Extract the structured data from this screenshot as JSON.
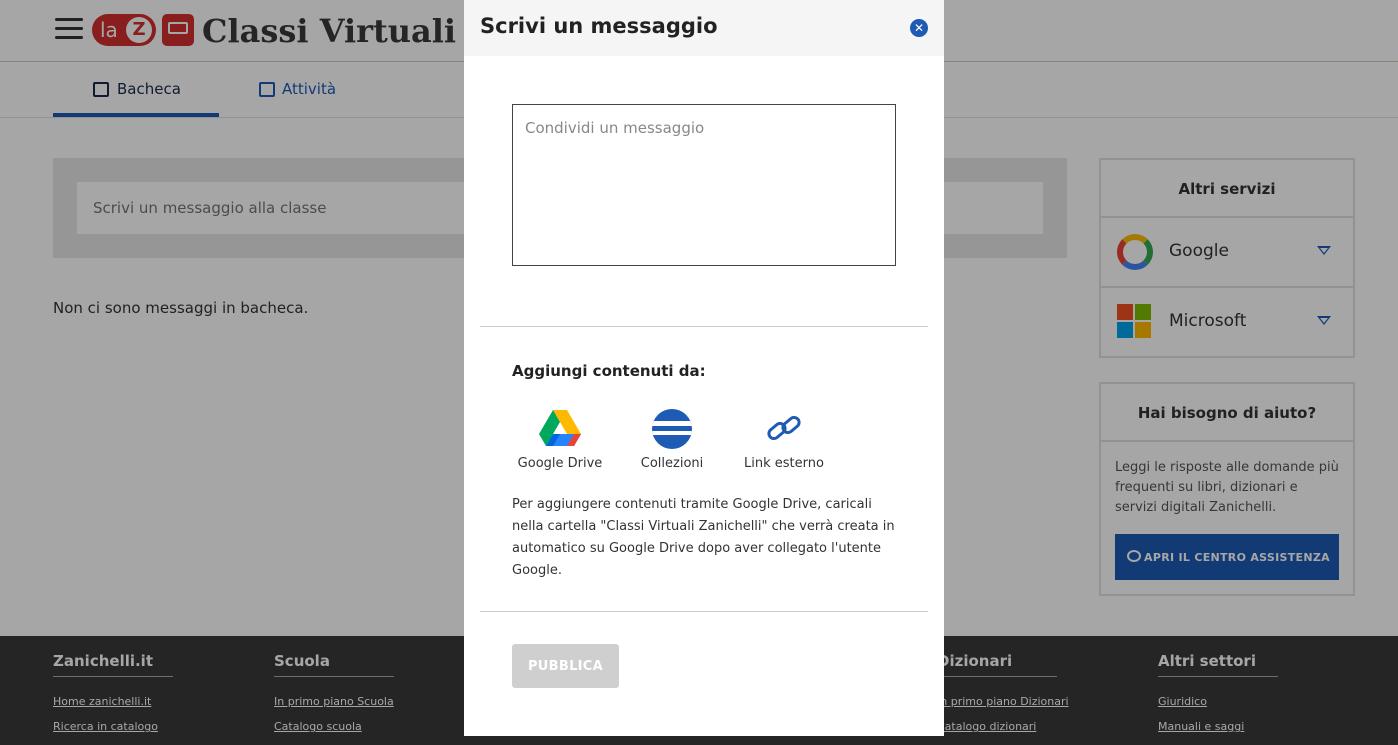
{
  "header": {
    "logo_text": "la",
    "logo_letter": "Z",
    "app_title": "Classi Virtuali"
  },
  "tabs": [
    {
      "label": "Bacheca",
      "active": true
    },
    {
      "label": "Attività",
      "active": false
    }
  ],
  "board": {
    "composer_placeholder": "Scrivi un messaggio alla classe",
    "empty_text": "Non ci sono messaggi in bacheca."
  },
  "services": {
    "title": "Altri servizi",
    "items": [
      {
        "name": "Google",
        "icon": "google-icon"
      },
      {
        "name": "Microsoft",
        "icon": "microsoft-icon"
      }
    ]
  },
  "help": {
    "title": "Hai bisogno di aiuto?",
    "text": "Leggi le risposte alle domande più frequenti su libri, dizionari e servizi digitali Zanichelli.",
    "button_label": "APRI IL CENTRO ASSISTENZA"
  },
  "footer": {
    "columns": [
      {
        "title": "Zanichelli.it",
        "links": [
          "Home zanichelli.it",
          "Ricerca in catalogo"
        ]
      },
      {
        "title": "Scuola",
        "links": [
          "In primo piano Scuola",
          "Catalogo scuola"
        ]
      },
      {
        "title": "Dizionari",
        "links": [
          "In primo piano Dizionari",
          "Catalogo dizionari"
        ]
      },
      {
        "title": "Altri settori",
        "links": [
          "Giuridico",
          "Manuali e saggi"
        ]
      }
    ]
  },
  "modal": {
    "title": "Scrivi un messaggio",
    "message_placeholder": "Condividi un messaggio",
    "add_label": "Aggiungi contenuti da:",
    "sources": [
      {
        "label": "Google Drive",
        "icon": "google-drive-icon"
      },
      {
        "label": "Collezioni",
        "icon": "collections-icon"
      },
      {
        "label": "Link esterno",
        "icon": "link-icon"
      }
    ],
    "info_text": "Per aggiungere contenuti tramite Google Drive, caricali nella cartella \"Classi Virtuali Zanichelli\" che verrà creata in automatico su Google Drive dopo aver collegato l'utente Google.",
    "publish_label": "PUBBLICA"
  },
  "colors": {
    "accent": "#1d5bb5",
    "brand_red": "#d32f2f",
    "footer_bg": "#3a3a3a"
  }
}
